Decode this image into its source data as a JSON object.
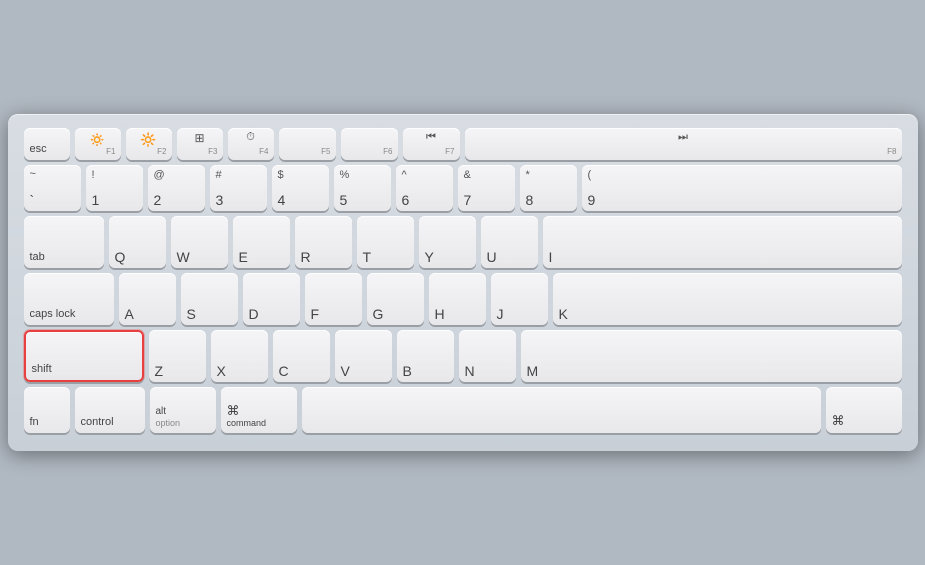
{
  "keyboard": {
    "rows": {
      "fn_row": {
        "keys": [
          {
            "id": "esc",
            "label": "esc",
            "fn": ""
          },
          {
            "id": "f1",
            "label": "☀",
            "fn": "F1"
          },
          {
            "id": "f2",
            "label": "☀",
            "fn": "F2"
          },
          {
            "id": "f3",
            "label": "⊞",
            "fn": "F3"
          },
          {
            "id": "f4",
            "label": "⏱",
            "fn": "F4"
          },
          {
            "id": "f5",
            "label": "",
            "fn": "F5"
          },
          {
            "id": "f6",
            "label": "",
            "fn": "F6"
          },
          {
            "id": "f7",
            "label": "⏮",
            "fn": "F7"
          },
          {
            "id": "f8",
            "label": "⏭",
            "fn": "F8"
          }
        ]
      },
      "num_row": {
        "keys": [
          {
            "top": "~",
            "bottom": "`"
          },
          {
            "top": "!",
            "bottom": "1"
          },
          {
            "top": "@",
            "bottom": "2"
          },
          {
            "top": "#",
            "bottom": "3"
          },
          {
            "top": "$",
            "bottom": "4"
          },
          {
            "top": "%",
            "bottom": "5"
          },
          {
            "top": "^",
            "bottom": "6"
          },
          {
            "top": "&",
            "bottom": "7"
          },
          {
            "top": "*",
            "bottom": "8"
          },
          {
            "top": "(",
            "bottom": "9"
          }
        ]
      },
      "qwerty_row": {
        "tab_label": "tab",
        "keys": [
          "Q",
          "W",
          "E",
          "R",
          "T",
          "Y",
          "U",
          "I"
        ]
      },
      "asdf_row": {
        "caps_label": "caps lock",
        "keys": [
          "A",
          "S",
          "D",
          "F",
          "G",
          "H",
          "J",
          "K"
        ]
      },
      "zxcv_row": {
        "shift_label": "shift",
        "keys": [
          "Z",
          "X",
          "C",
          "V",
          "B",
          "N",
          "M"
        ]
      },
      "bottom_row": {
        "fn_label": "fn",
        "control_label": "control",
        "alt_label": "alt",
        "option_label": "option",
        "cmd_label": "command",
        "cmd_symbol": "⌘"
      }
    }
  }
}
